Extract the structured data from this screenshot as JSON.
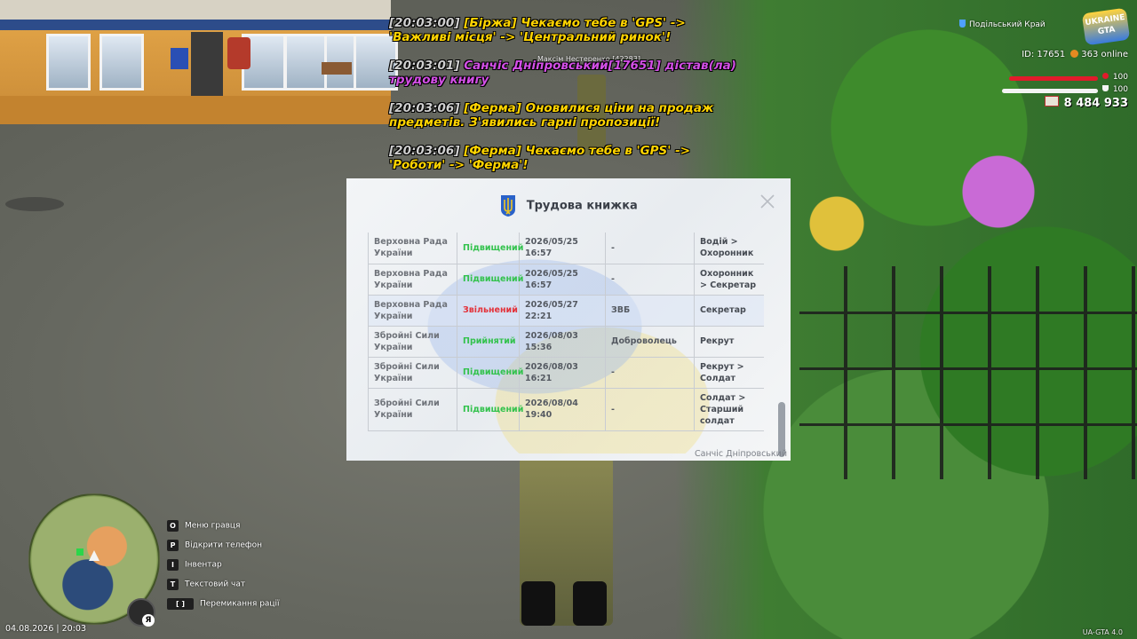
{
  "chat": [
    {
      "time": "[20:03:00]",
      "text": "[Біржа] Чекаємо тебе в 'GPS' -> 'Важливі місця' -> 'Центральний ринок'!",
      "color": "#ffd400"
    },
    {
      "time": "[20:03:01]",
      "text": "Санчіс Дніпровський[17651] дістав(ла) трудову книгу",
      "color": "#d34fe6"
    },
    {
      "time": "[20:03:06]",
      "text": "[Ферма] Оновилися ціни на продаж предметів. З'явились гарні пропозиції!",
      "color": "#ffd400"
    },
    {
      "time": "[20:03:06]",
      "text": "[Ферма] Чекаємо тебе в 'GPS' -> 'Роботи' -> 'Ферма'!",
      "color": "#ffd400"
    }
  ],
  "npc_label": "Максім Нестеренко [42283]",
  "hud": {
    "region": "Подільський Край",
    "logo": "UKRAINE GTA",
    "id_text": "ID: 17651",
    "online_text": "363 online",
    "health": "100",
    "armor": "100",
    "money": "8 484 933"
  },
  "workbook": {
    "title": "Трудова книжка",
    "owner": "Санчіс Дніпровський",
    "rows": [
      {
        "org": "Верховна Рада України",
        "status": "Підвищений",
        "status_type": "up",
        "date": "2026/05/25 16:57",
        "reason": "-",
        "position": "Водій > Охоронник"
      },
      {
        "org": "Верховна Рада України",
        "status": "Підвищений",
        "status_type": "up",
        "date": "2026/05/25 16:57",
        "reason": "-",
        "position": "Охоронник > Секретар"
      },
      {
        "org": "Верховна Рада України",
        "status": "Звільнений",
        "status_type": "fire",
        "date": "2026/05/27 22:21",
        "reason": "ЗВБ",
        "position": "Секретар"
      },
      {
        "org": "Збройні Сили України",
        "status": "Прийнятий",
        "status_type": "hire",
        "date": "2026/08/03 15:36",
        "reason": "Доброволець",
        "position": "Рекрут"
      },
      {
        "org": "Збройні Сили України",
        "status": "Підвищений",
        "status_type": "up",
        "date": "2026/08/03 16:21",
        "reason": "-",
        "position": "Рекрут > Солдат"
      },
      {
        "org": "Збройні Сили України",
        "status": "Підвищений",
        "status_type": "up",
        "date": "2026/08/04 19:40",
        "reason": "-",
        "position": "Солдат > Старший солдат"
      }
    ]
  },
  "hints": [
    {
      "key": "O",
      "label": "Меню гравця"
    },
    {
      "key": "P",
      "label": "Відкрити телефон"
    },
    {
      "key": "I",
      "label": "Інвентар"
    },
    {
      "key": "T",
      "label": "Текстовий чат"
    },
    {
      "key": "[ ]",
      "label": "Перемикання рації"
    }
  ],
  "compass_letter": "Я",
  "datetime": "04.08.2026 | 20:03",
  "version": "UA-GTA 4.0",
  "colors": {
    "chat_yellow": "#ffd400",
    "chat_magenta": "#d34fe6",
    "status_green": "#33c24d",
    "status_red": "#e3323a",
    "health": "#e21b2b"
  }
}
